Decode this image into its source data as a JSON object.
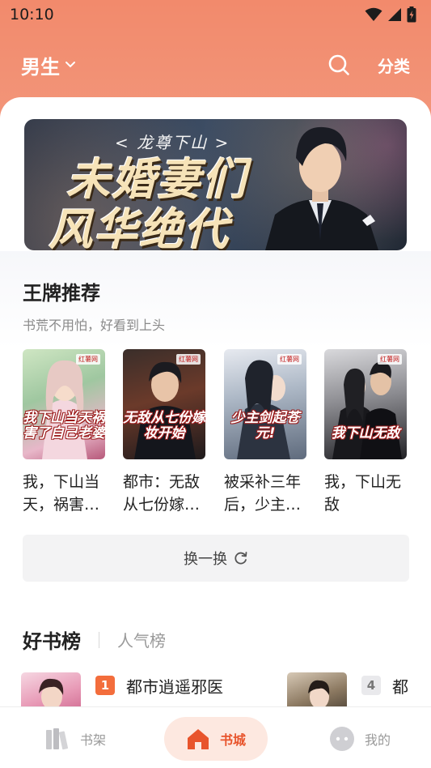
{
  "status_bar": {
    "time": "10:10"
  },
  "header": {
    "gender": "男生",
    "category": "分类"
  },
  "banner": {
    "subtitle": "< 龙尊下山 >",
    "title_line1": "未婚妻们",
    "title_line2": "风华绝代"
  },
  "recommend": {
    "title": "王牌推荐",
    "subtitle": "书荒不用怕，好看到上头",
    "books": [
      {
        "name": "我，下山当天，祸害了自己老婆",
        "cover_text": "我下山当天祸害了自己老婆",
        "tag": "红薯网"
      },
      {
        "name": "都市：无敌从七份嫁妆开始",
        "cover_text": "无敌从七份嫁妆开始",
        "tag": "红薯网"
      },
      {
        "name": "被采补三年后，少主剑起苍元！",
        "cover_text": "少主剑起苍元!",
        "tag": "红薯网"
      },
      {
        "name": "我，下山无敌",
        "cover_text": "我下山无敌",
        "tag": "红薯网"
      }
    ],
    "refresh_label": "换一换"
  },
  "ranking": {
    "active_tab": "好书榜",
    "other_tab": "人气榜",
    "items": [
      {
        "rank": "1",
        "title": "都市逍遥邪医",
        "color": "#f36d3c"
      },
      {
        "rank": "4",
        "title": "都",
        "color": "#e9e9ec"
      }
    ]
  },
  "tab_bar": {
    "items": [
      {
        "label": "书架"
      },
      {
        "label": "书城"
      },
      {
        "label": "我的"
      }
    ]
  },
  "colors": {
    "accent": "#e8542c",
    "header_bg": "#f28a6c"
  }
}
